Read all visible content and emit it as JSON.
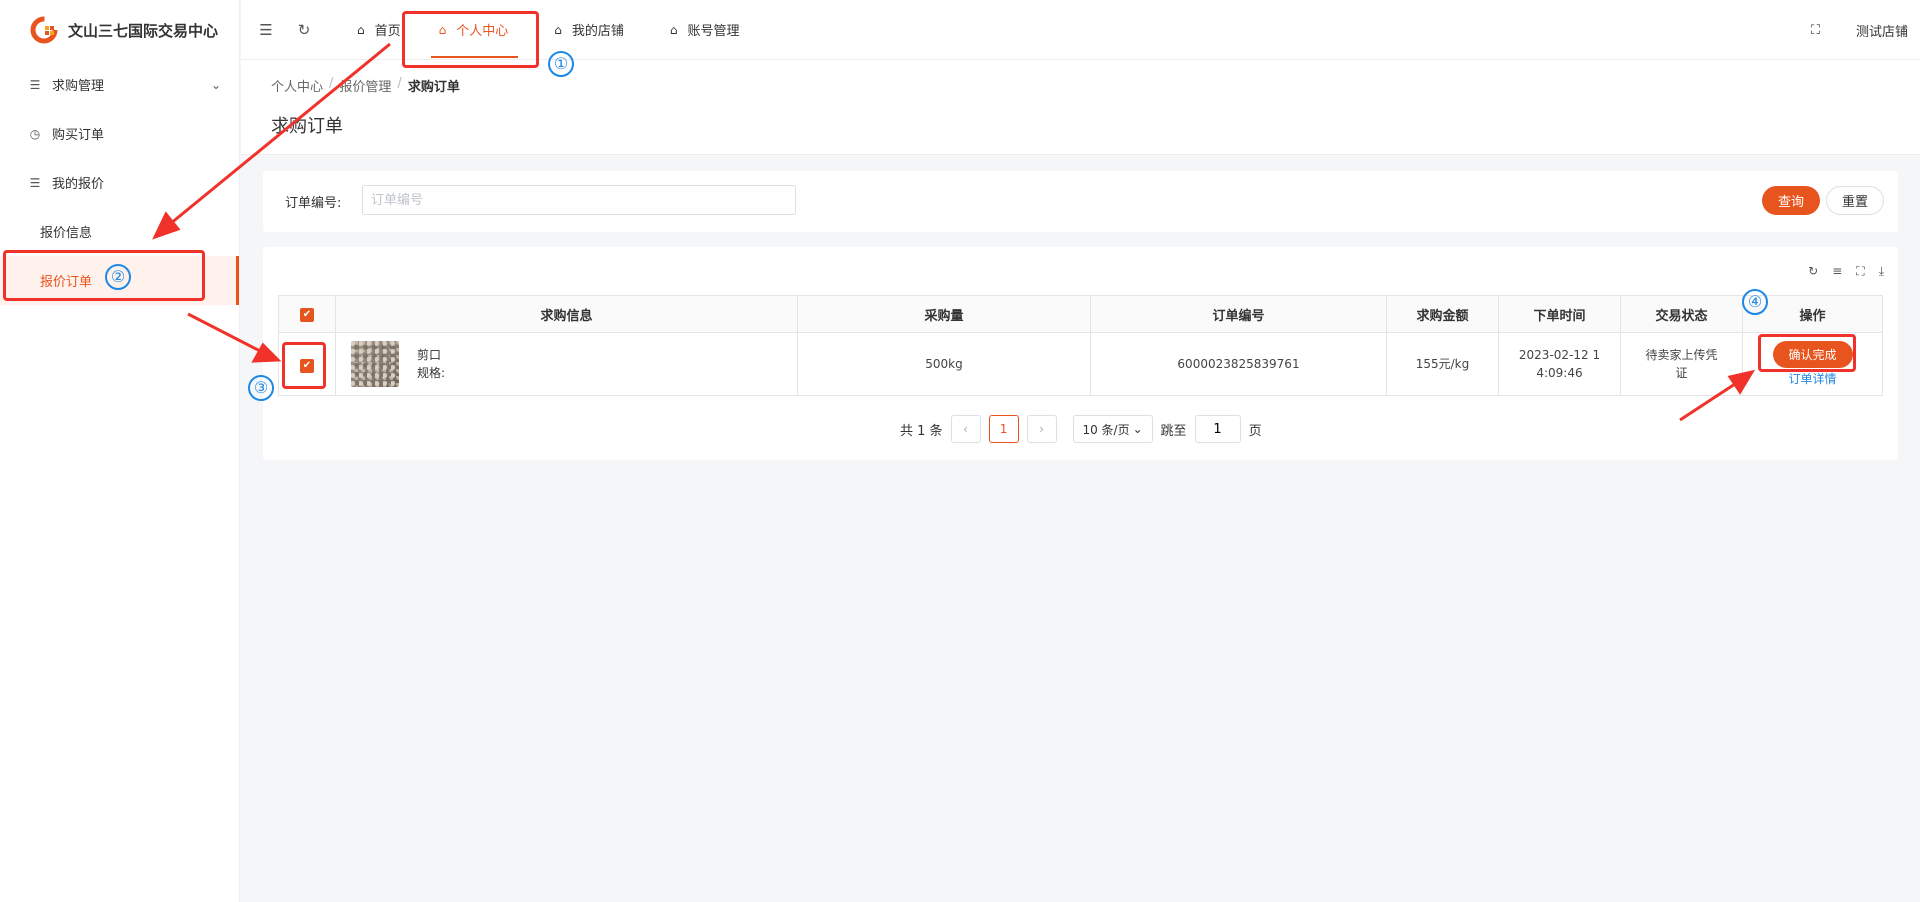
{
  "app": {
    "title": "文山三七国际交易中心"
  },
  "sidebar": {
    "items": [
      {
        "label": "求购管理",
        "icon": "sliders-icon",
        "expandable": true
      },
      {
        "label": "购买订单",
        "icon": "clock-icon"
      },
      {
        "label": "我的报价",
        "icon": "sliders-icon"
      }
    ],
    "subitems": [
      {
        "label": "报价信息"
      },
      {
        "label": "报价订单",
        "active": true
      }
    ]
  },
  "topbar": {
    "tabs": [
      {
        "label": "首页"
      },
      {
        "label": "个人中心",
        "active": true
      },
      {
        "label": "我的店铺"
      },
      {
        "label": "账号管理"
      }
    ],
    "shop_name": "测试店铺"
  },
  "breadcrumb": [
    "个人中心",
    "报价管理",
    "求购订单"
  ],
  "page_title": "求购订单",
  "search": {
    "label": "订单编号:",
    "placeholder": "订单编号",
    "query_label": "查询",
    "reset_label": "重置"
  },
  "table": {
    "headers": [
      "求购信息",
      "采购量",
      "订单编号",
      "求购金额",
      "下单时间",
      "交易状态",
      "操作"
    ],
    "rows": [
      {
        "goods_name": "剪口",
        "goods_spec": "规格:",
        "quantity": "500kg",
        "order_no": "6000023825839761",
        "amount": "155元/kg",
        "time_line1": "2023-02-12 1",
        "time_line2": "4:09:46",
        "status_line1": "待卖家上传凭",
        "status_line2": "证",
        "action_confirm": "确认完成",
        "action_detail": "订单详情",
        "checked": true
      }
    ]
  },
  "pager": {
    "total": "共 1 条",
    "current": "1",
    "page_size": "10 条/页",
    "jump_label": "跳至",
    "jump_value": "1",
    "page_suffix": "页"
  },
  "annotations": [
    "①",
    "②",
    "③",
    "④"
  ],
  "colors": {
    "accent": "#e8541e",
    "annotation_red": "#f0322a",
    "annotation_blue": "#1e88e5"
  }
}
